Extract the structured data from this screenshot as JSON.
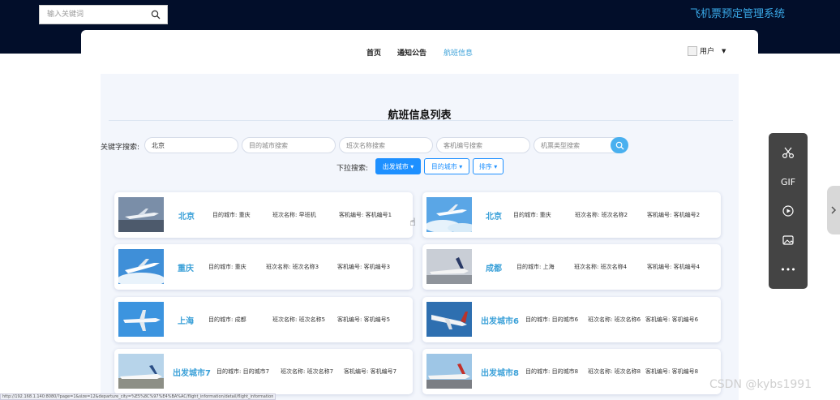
{
  "header": {
    "search_placeholder": "输入关键词",
    "system_title": "飞机票预定管理系统"
  },
  "nav": {
    "items": [
      "首页",
      "通知公告",
      "航班信息"
    ],
    "active_index": 2,
    "user_label": "用户"
  },
  "page": {
    "title": "航班信息列表",
    "keyword_label": "关键字搜索:",
    "keyword_inputs": [
      {
        "value": "北京",
        "placeholder": ""
      },
      {
        "value": "",
        "placeholder": "目的城市搜索"
      },
      {
        "value": "",
        "placeholder": "班次名称搜索"
      },
      {
        "value": "",
        "placeholder": "客机编号搜索"
      },
      {
        "value": "",
        "placeholder": "机票类型搜索"
      }
    ],
    "dropdown_label": "下拉搜索:",
    "dropdowns": [
      "出发城市",
      "目的城市",
      "排序"
    ]
  },
  "flights": [
    {
      "city": "北京",
      "dest": "目的城市: 重庆",
      "shift": "班次名称: 早班机",
      "plane": "客机编号: 客机编号1"
    },
    {
      "city": "北京",
      "dest": "目的城市: 重庆",
      "shift": "班次名称: 班次名称2",
      "plane": "客机编号: 客机编号2"
    },
    {
      "city": "重庆",
      "dest": "目的城市: 重庆",
      "shift": "班次名称: 班次名称3",
      "plane": "客机编号: 客机编号3"
    },
    {
      "city": "成都",
      "dest": "目的城市: 上海",
      "shift": "班次名称: 班次名称4",
      "plane": "客机编号: 客机编号4"
    },
    {
      "city": "上海",
      "dest": "目的城市: 成都",
      "shift": "班次名称: 班次名称5",
      "plane": "客机编号: 客机编号5"
    },
    {
      "city": "出发城市6",
      "dest": "目的城市: 目的城市6",
      "shift": "班次名称: 班次名称6",
      "plane": "客机编号: 客机编号6"
    },
    {
      "city": "出发城市7",
      "dest": "目的城市: 目的城市7",
      "shift": "班次名称: 班次名称7",
      "plane": "客机编号: 客机编号7"
    },
    {
      "city": "出发城市8",
      "dest": "目的城市: 目的城市8",
      "shift": "班次名称: 班次名称8",
      "plane": "客机编号: 客机编号8"
    }
  ],
  "toolbar": {
    "gif_label": "GIF",
    "more_label": "•••"
  },
  "watermark": "CSDN @kybs1991",
  "status_url": "http://192.168.1.140:8080/?page=1&size=12&departure_city=%E5%8C%97%E4%BA%AC/flight_information/detail/flight_information"
}
